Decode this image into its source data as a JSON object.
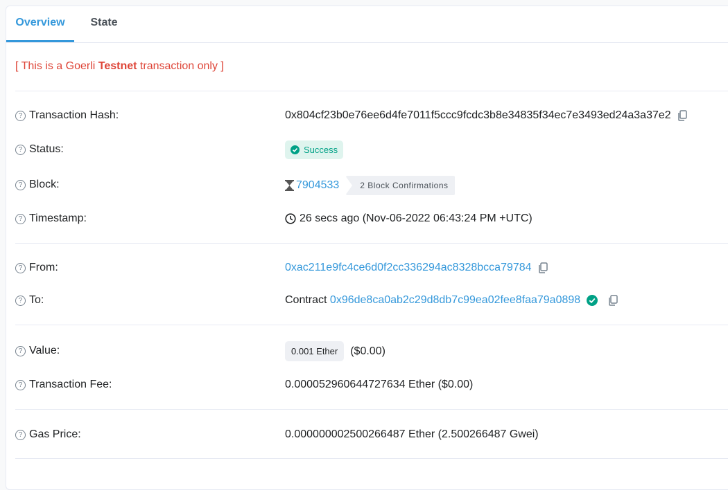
{
  "tabs": [
    {
      "label": "Overview",
      "active": true
    },
    {
      "label": "State",
      "active": false
    }
  ],
  "notice": {
    "prefix": "[ This is a Goerli ",
    "bold": "Testnet",
    "suffix": " transaction only ]"
  },
  "rows": {
    "tx_hash": {
      "label": "Transaction Hash:",
      "value": "0x804cf23b0e76ee6d4fe7011f5ccc9fcdc3b8e34835f34ec7e3493ed24a3a37e2"
    },
    "status": {
      "label": "Status:",
      "value": "Success"
    },
    "block": {
      "label": "Block:",
      "value": "7904533",
      "confirmations": "2 Block Confirmations"
    },
    "timestamp": {
      "label": "Timestamp:",
      "value": "26 secs ago (Nov-06-2022 06:43:24 PM +UTC)"
    },
    "from": {
      "label": "From:",
      "value": "0xac211e9fc4ce6d0f2cc336294ac8328bcca79784"
    },
    "to": {
      "label": "To:",
      "prefix": "Contract",
      "value": "0x96de8ca0ab2c29d8db7c99ea02fee8faa79a0898"
    },
    "value": {
      "label": "Value:",
      "amount": "0.001 Ether",
      "usd": "($0.00)"
    },
    "fee": {
      "label": "Transaction Fee:",
      "value": "0.000052960644727634 Ether ($0.00)"
    },
    "gas_price": {
      "label": "Gas Price:",
      "value": "0.000000002500266487 Ether (2.500266487 Gwei)"
    }
  },
  "icons": {
    "help": "question-circle-icon",
    "copy": "copy-icon",
    "check": "check-circle-icon",
    "hourglass": "hourglass-icon",
    "clock": "clock-icon"
  },
  "colors": {
    "accent": "#3498db",
    "danger": "#de4437",
    "success": "#00a186"
  }
}
